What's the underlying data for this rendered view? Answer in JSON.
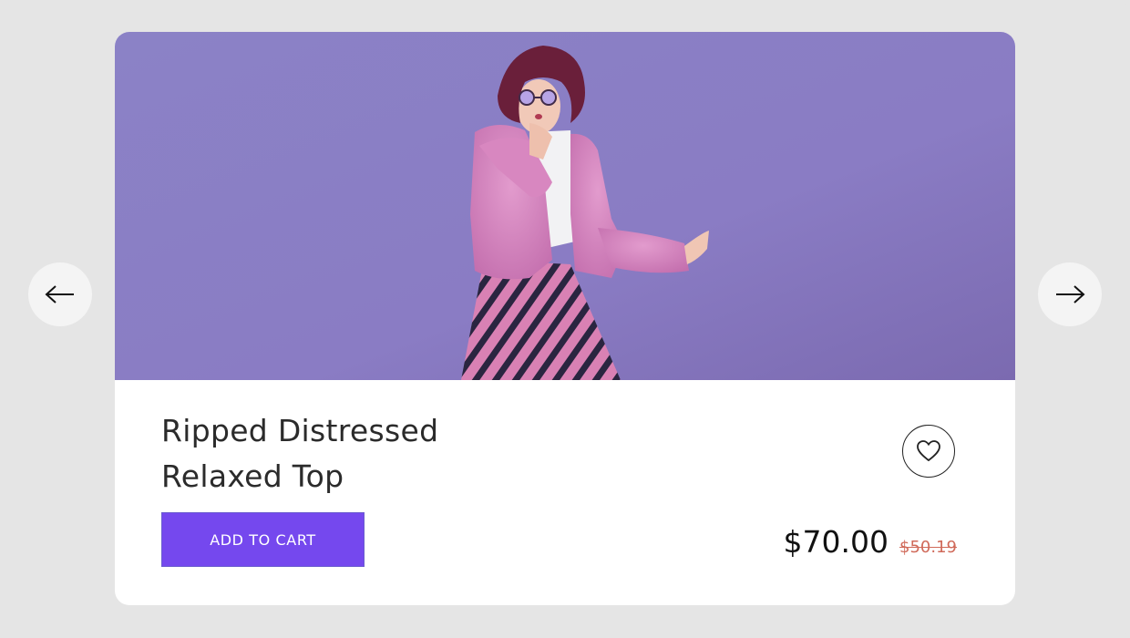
{
  "product": {
    "title_line1": "Ripped Distressed",
    "title_line2": "Relaxed Top",
    "add_to_cart_label": "ADD TO CART",
    "price": "$70.00",
    "old_price": "$50.19"
  },
  "image": {
    "subject": "woman in pink faux-fur jacket and striped pants on purple background"
  },
  "icons": {
    "prev": "arrow-left-icon",
    "next": "arrow-right-icon",
    "wishlist": "heart-icon"
  },
  "colors": {
    "page_bg": "#e5e5e5",
    "card_bg": "#ffffff",
    "hero_bg": "#8a7cc4",
    "button_bg": "#7548ee",
    "old_price": "#d06a5a"
  }
}
